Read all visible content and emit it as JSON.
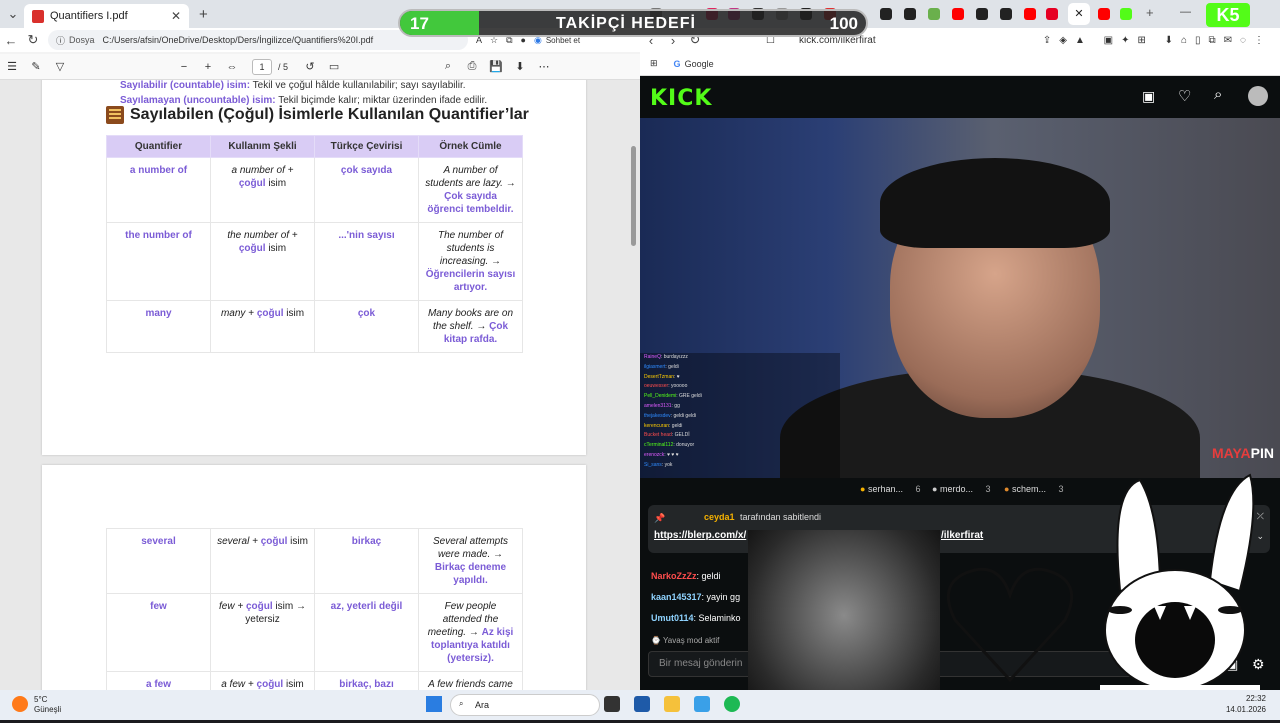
{
  "left_browser": {
    "tab_title": "Quantifiers I.pdf",
    "address_label": "Dosya",
    "url": "C:/Users/afsin/OneDrive/Desktop/Ders/İngilizce/Quantifiers%20I.pdf",
    "chat_button": "Sohbet et",
    "page_current": "1",
    "page_total": "/ 5"
  },
  "pdf": {
    "intro": [
      {
        "term": "Sayılabilir (countable) isim:",
        "text": " Tekil ve çoğul hâlde kullanılabilir; sayı sayılabilir."
      },
      {
        "term": "Sayılamayan (uncountable) isim:",
        "text": " Tekil biçimde kalır; miktar üzerinden ifade edilir."
      }
    ],
    "heading": "Sayılabilen (Çoğul) İsimlerle Kullanılan Quantifier’lar",
    "headers": [
      "Quantifier",
      "Kullanım Şekli",
      "Türkçe Çevirisi",
      "Örnek Cümle"
    ],
    "rows1": [
      {
        "q": "a number of",
        "u1": "a number of +",
        "u2": "çoğul",
        "u3": " isim",
        "t": "çok sayıda",
        "e1": "A number of students are lazy. → ",
        "e2": "Çok sayıda öğrenci tembeldir."
      },
      {
        "q": "the number of",
        "u1": "the number of +",
        "u2": "çoğul",
        "u3": " isim",
        "t": "...'nin sayısı",
        "e1": "The number of students is increasing. → ",
        "e2": "Öğrencilerin sayısı artıyor."
      },
      {
        "q": "many",
        "u1": "many + ",
        "u2": "çoğul",
        "u3": " isim",
        "t": "çok",
        "e1": "Many books are on the shelf. → ",
        "e2": "Çok kitap rafda."
      }
    ],
    "rows2": [
      {
        "q": "several",
        "u1": "several + ",
        "u2": "çoğul",
        "u3": " isim",
        "t": "birkaç",
        "e1": "Several attempts were made. → ",
        "e2": "Birkaç deneme yapıldı."
      },
      {
        "q": "few",
        "u1": "few + ",
        "u2": "çoğul",
        "u3": " isim → yetersiz",
        "t": "az, yeterli değil",
        "e1": "Few people attended the meeting. → ",
        "e2": "Az kişi toplantıya katıldı (yetersiz)."
      },
      {
        "q": "a few",
        "u1": "a few + ",
        "u2": "çoğul",
        "u3": " isim",
        "t": "birkaç, bazı",
        "e1": "A few friends came",
        "e2": ""
      }
    ]
  },
  "overlay": {
    "goal_current": "17",
    "goal_label": "TAKİPÇİ HEDEFİ",
    "goal_target": "100",
    "goal_progress": 0.17,
    "badge_count": "5"
  },
  "right_browser": {
    "url": "kick.com/ilkerfirat",
    "bookmark": "Google",
    "kick_logo": "KICK",
    "sponsor_brand": "MAYA",
    "sponsor_brand2": "PIN",
    "viewers": [
      {
        "name": "serhan...",
        "count": "6"
      },
      {
        "name": "merdo...",
        "count": "3"
      },
      {
        "name": "schem...",
        "count": "3"
      }
    ],
    "pinned_user": "ceyda1",
    "pinned_by": "tarafından sabitlendi",
    "pinned_link": "https://blerp.com/x/",
    "pinned_link_tail": "/ilkerfirat",
    "chat": [
      {
        "user": "NarkoZzZz",
        "msg": ": geldi"
      },
      {
        "user": "kaan145317",
        "msg": ": yayin gg"
      },
      {
        "user": "Umut0114",
        "msg": ": Selaminko"
      }
    ],
    "slow_mode": "Yavaş mod aktif",
    "message_placeholder": "Bir mesaj gönderin",
    "video_chat": [
      {
        "u": "RaineQ",
        "m": ": burdayızzz"
      },
      {
        "u": "ilgiasmert",
        "m": ": geldi"
      },
      {
        "u": "DesertTzman",
        "m": ": ♥"
      },
      {
        "u": "oeuwesser",
        "m": ": yooooo"
      },
      {
        "u": "Pell_Denidemi",
        "m": ": GRE geldi"
      },
      {
        "u": "amelen3131",
        "m": ": gg"
      },
      {
        "u": "thejakesdev",
        "m": ": geldi geldi"
      },
      {
        "u": "kerencuran",
        "m": ": geldi"
      },
      {
        "u": "Bucket head",
        "m": ": GELDİ"
      },
      {
        "u": "cTerminal112",
        "m": ": donuyor"
      },
      {
        "u": "erenozck",
        "m": ": ♥ ♥ ♥"
      },
      {
        "u": "Si_sans",
        "m": ": yok"
      }
    ]
  },
  "taskbar": {
    "weather_temp": "5°C",
    "weather_desc": "Güneşli",
    "search": "Ara",
    "time": "22:32",
    "date": "14.01.2026"
  }
}
